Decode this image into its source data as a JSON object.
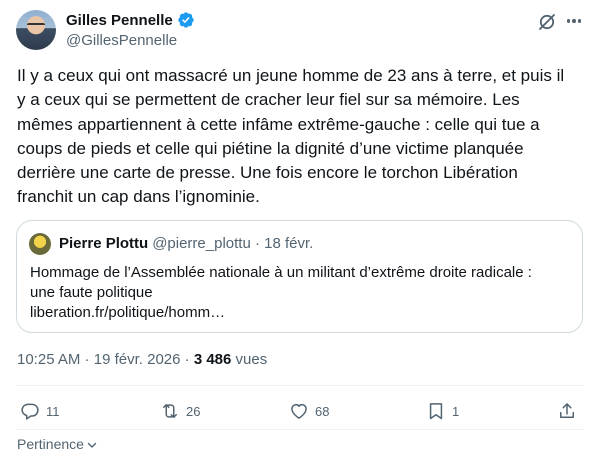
{
  "author": {
    "name": "Gilles Pennelle",
    "handle": "@GillesPennelle"
  },
  "icons": {
    "verified": "verified-badge-icon",
    "grok": "grok-icon",
    "more": "more-icon",
    "reply": "reply-icon",
    "retweet": "retweet-icon",
    "like": "heart-icon",
    "bookmark": "bookmark-icon",
    "share": "share-icon",
    "chevron": "chevron-down-icon"
  },
  "colors": {
    "verified": "#1d9bf0",
    "secondary_text": "#536471",
    "primary_text": "#0f1419",
    "border": "#cfd9de"
  },
  "tweet": {
    "text": "Il y a ceux qui ont massacré un jeune homme de 23 ans à terre, et puis il\ny a ceux qui se permettent de cracher leur fiel sur sa mémoire. Les\nmêmes appartiennent à cette infâme extrême-gauche : celle qui tue a\ncoups de pieds et celle qui piétine la dignité d’une victime planquée\nderrière une carte de presse. Une fois encore le torchon Libération\nfranchit un cap dans l’ignominie."
  },
  "quoted": {
    "name": "Pierre Plottu",
    "handle": "@pierre_plottu",
    "separator": " · ",
    "date": "18 févr.",
    "text": "Hommage de l’Assemblée nationale à un militant d’extrême droite radicale :\nune faute politique\nliberation.fr/politique/homm…"
  },
  "meta": {
    "time": "10:25 AM",
    "separator": " · ",
    "date": "19 févr. 2026",
    "separator2": " · ",
    "views_count": "3 486",
    "views_label": " vues"
  },
  "actions": {
    "replies": "11",
    "retweets": "26",
    "likes": "68",
    "bookmarks": "1"
  },
  "reply_sort": {
    "label": "Pertinence"
  }
}
